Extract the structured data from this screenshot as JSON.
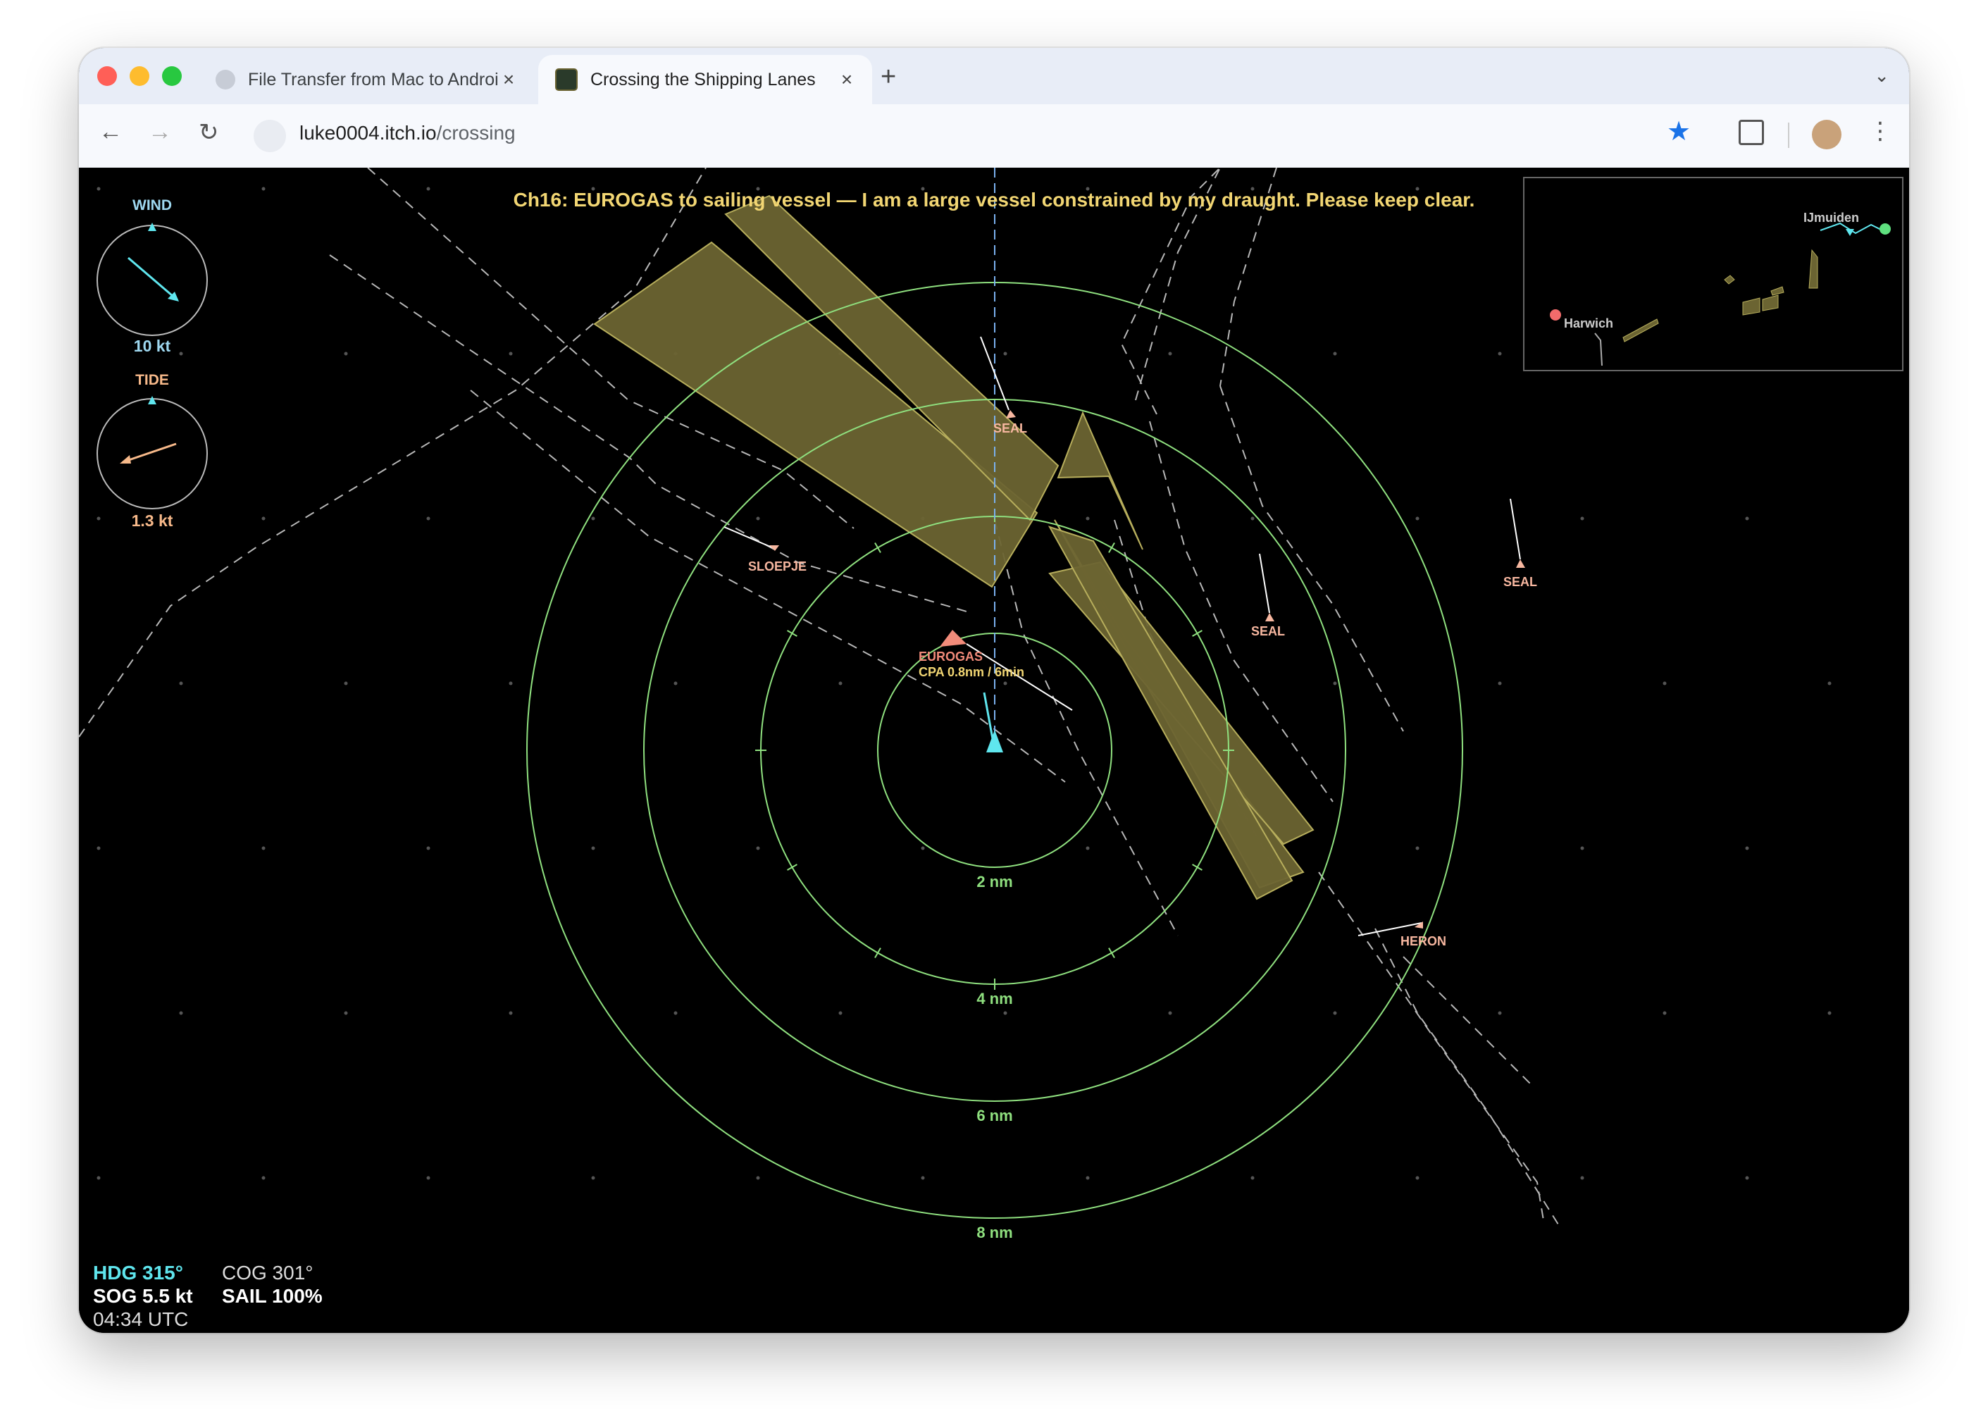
{
  "browser": {
    "tabs": [
      {
        "title": "File Transfer from Mac to Android",
        "active": false
      },
      {
        "title": "Crossing the Shipping Lanes",
        "active": true
      }
    ],
    "url_host": "luke0004.itch.io",
    "url_path": "/crossing",
    "icons": {
      "back": "back-arrow-icon",
      "forward": "forward-arrow-icon",
      "reload": "reload-icon",
      "bookmark": "star-icon",
      "extensions": "puzzle-icon",
      "menu": "kebab-icon"
    }
  },
  "game": {
    "radio_message": "Ch16: EUROGAS to sailing vessel — I am a large vessel constrained by my draught. Please keep clear.",
    "wind": {
      "label": "WIND",
      "speed": "10 kt",
      "direction_deg": 315
    },
    "tide": {
      "label": "TIDE",
      "speed": "1.3 kt",
      "direction_deg": 70
    },
    "range_rings": [
      "2 nm",
      "4 nm",
      "6 nm",
      "8 nm"
    ],
    "vessels": [
      {
        "name": "EUROGAS",
        "cpa": "CPA 0.8nm / 6min"
      },
      {
        "name": "SEAL"
      },
      {
        "name": "SLOEPJE"
      },
      {
        "name": "SEAL"
      },
      {
        "name": "SEAL"
      },
      {
        "name": "HERON"
      }
    ],
    "minimap": {
      "places": [
        "IJmuiden",
        "Harwich"
      ]
    },
    "hud": {
      "hdg": "HDG 315°",
      "sog": "SOG 5.5 kt",
      "time": "04:34 UTC",
      "cog": "COG 301°",
      "sail": "SAIL 100%"
    },
    "colors": {
      "rings": "#8fe07f",
      "tss": "#6b6432",
      "own_ship": "#5fe6ee",
      "vessel": "#f7b7a0",
      "message": "#f2d673"
    }
  }
}
